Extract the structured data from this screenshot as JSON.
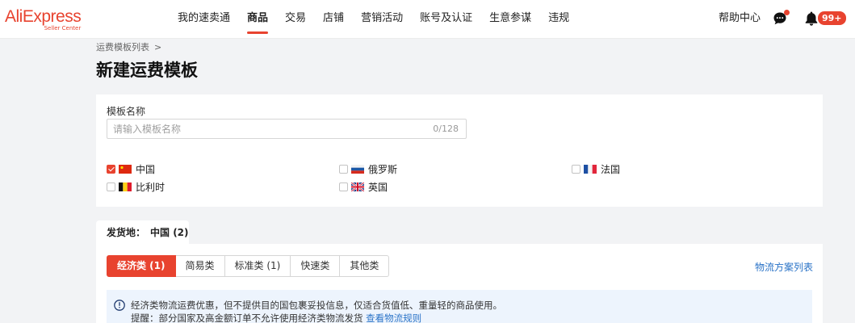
{
  "header": {
    "logo_text": "AliExpress",
    "logo_sub": "Seller Center",
    "nav": [
      {
        "label": "我的速卖通",
        "active": false
      },
      {
        "label": "商品",
        "active": true
      },
      {
        "label": "交易",
        "active": false
      },
      {
        "label": "店铺",
        "active": false
      },
      {
        "label": "营销活动",
        "active": false
      },
      {
        "label": "账号及认证",
        "active": false
      },
      {
        "label": "生意参谋",
        "active": false
      },
      {
        "label": "违规",
        "active": false
      }
    ],
    "help": "帮助中心",
    "badge": "99+",
    "icons": [
      "chat-icon",
      "bell-icon"
    ],
    "accent_color": "#e8432f"
  },
  "breadcrumb": {
    "parent": "运费模板列表",
    "separator": ">"
  },
  "page_title": "新建运费模板",
  "template_name": {
    "label": "模板名称",
    "value": "",
    "placeholder": "请输入模板名称",
    "counter": "0/128"
  },
  "countries": [
    {
      "name": "中国",
      "checked": true,
      "flag": "cn-flag-icon"
    },
    {
      "name": "俄罗斯",
      "checked": false,
      "flag": "ru-flag-icon"
    },
    {
      "name": "法国",
      "checked": false,
      "flag": "fr-flag-icon"
    },
    {
      "name": "比利时",
      "checked": false,
      "flag": "be-flag-icon"
    },
    {
      "name": "英国",
      "checked": false,
      "flag": "uk-flag-icon"
    }
  ],
  "ship_from": {
    "label": "发货地：",
    "value": "中国 (2)"
  },
  "shipping_types": [
    {
      "label": "经济类 (1)",
      "active": true
    },
    {
      "label": "简易类",
      "active": false
    },
    {
      "label": "标准类 (1)",
      "active": false
    },
    {
      "label": "快速类",
      "active": false
    },
    {
      "label": "其他类",
      "active": false
    }
  ],
  "plan_link": "物流方案列表",
  "notice": {
    "line1": "经济类物流运费优惠，但不提供目的国包裹妥投信息，仅适合货值低、重量轻的商品使用。",
    "line2_prefix": "提醒：部分国家及高金额订单不允许使用经济类物流发货",
    "line2_link": "查看物流规则",
    "link_color": "#2a73c7"
  }
}
